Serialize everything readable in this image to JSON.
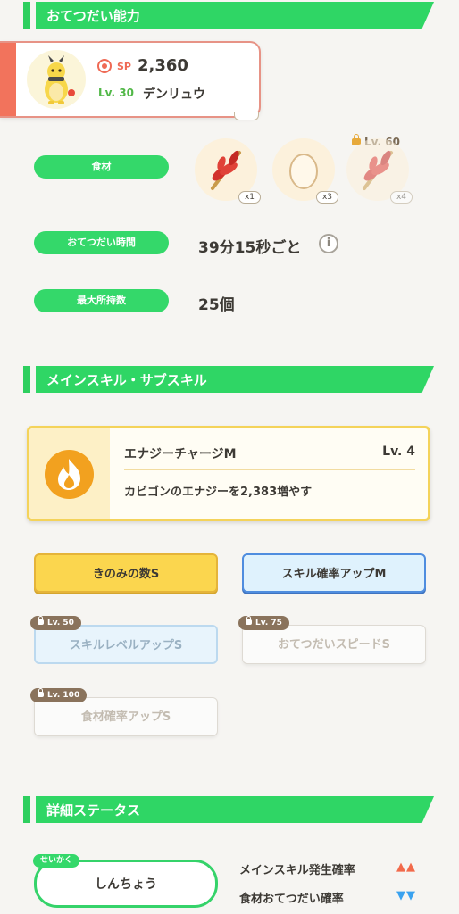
{
  "sections": {
    "help": "おてつだい能力",
    "skills": "メインスキル・サブスキル",
    "details": "詳細ステータス"
  },
  "pokemon": {
    "sp_label": "SP",
    "sp_value": "2,360",
    "level": "Lv. 30",
    "name": "デンリュウ"
  },
  "stats": {
    "ingredients_label": "食材",
    "help_time_label": "おてつだい時間",
    "help_time_value": "39分15秒ごと",
    "max_carry_label": "最大所持数",
    "max_carry_value": "25個",
    "info_glyph": "i"
  },
  "ingredients": [
    {
      "icon": "herb-icon",
      "qty": "x1"
    },
    {
      "icon": "egg-icon",
      "qty": "x3"
    },
    {
      "icon": "herb-icon",
      "qty": "x4",
      "lock_level": "Lv. 60"
    }
  ],
  "main_skill": {
    "name": "エナジーチャージM",
    "level": "Lv. 4",
    "description": "カビゴンのエナジーを2,383増やす"
  },
  "sub_skills": [
    {
      "label": "きのみの数S",
      "style": "gold"
    },
    {
      "label": "スキル確率アップM",
      "style": "blue"
    },
    {
      "label": "スキルレベルアップS",
      "style": "blue-locked",
      "lock_level": "Lv. 50"
    },
    {
      "label": "おてつだいスピードS",
      "style": "white-locked",
      "lock_level": "Lv. 75"
    },
    {
      "label": "食材確率アップS",
      "style": "white-locked",
      "lock_level": "Lv. 100"
    }
  ],
  "nature": {
    "tag": "せいかく",
    "name": "しんちょう",
    "up_effect": "メインスキル発生確率",
    "up_arrows": "▲▲",
    "down_effect": "食材おてつだい確率",
    "down_arrows": "▼▼"
  },
  "colors": {
    "green": "#2fd665",
    "up": "#f26a4b",
    "down": "#3aa2ef",
    "gold": "#fbd64e"
  }
}
